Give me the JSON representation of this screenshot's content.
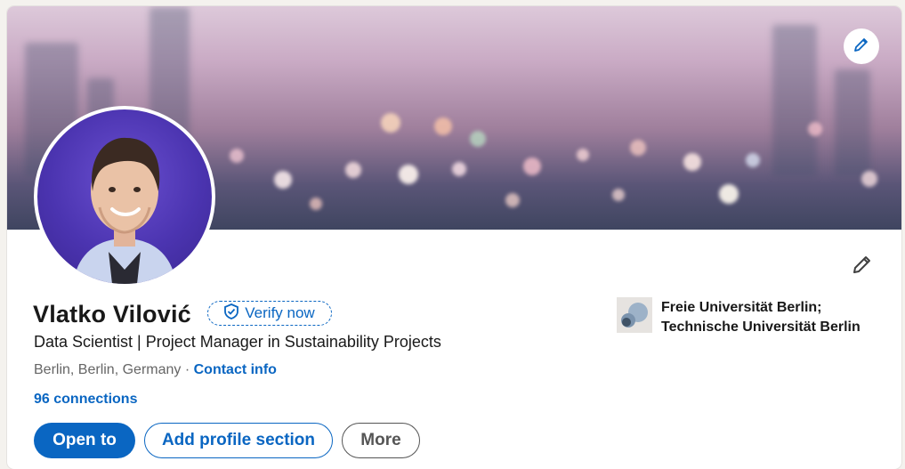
{
  "profile": {
    "name": "Vlatko Vilović",
    "verify_label": "Verify now",
    "headline": "Data Scientist | Project Manager in Sustainability Projects",
    "location": "Berlin, Berlin, Germany",
    "location_separator": " · ",
    "contact_label": "Contact info",
    "connections": "96 connections"
  },
  "education": {
    "line1": "Freie Universität Berlin;",
    "line2": "Technische Universität Berlin"
  },
  "actions": {
    "open_to": "Open to",
    "add_section": "Add profile section",
    "more": "More"
  },
  "colors": {
    "accent": "#0a66c2",
    "avatar_bg": "#4b34b0"
  },
  "icons": {
    "banner_edit": "pencil-icon",
    "profile_edit": "pencil-icon",
    "verify": "shield-check-icon"
  }
}
